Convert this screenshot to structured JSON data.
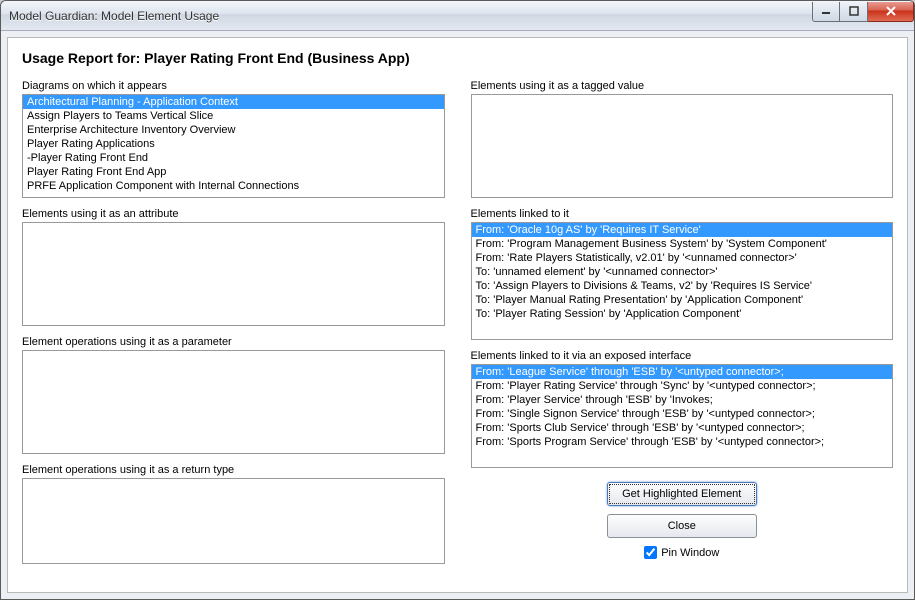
{
  "window": {
    "title": "Model Guardian: Model Element Usage"
  },
  "report": {
    "title": "Usage Report for: Player Rating Front End (Business App)"
  },
  "labels": {
    "diagrams": "Diagrams on which it appears",
    "tagged": "Elements using it as a tagged value",
    "attribute": "Elements using it as an attribute",
    "linked": "Elements linked to it",
    "parameter": "Element operations using it as a parameter",
    "exposed": "Elements linked to it via an exposed interface",
    "returntype": "Element operations using it as a return type"
  },
  "diagrams": {
    "items": [
      "Architectural Planning - Application Context",
      "Assign Players to Teams Vertical Slice",
      "Enterprise Architecture Inventory Overview",
      "Player Rating Applications",
      "-Player Rating Front End",
      "Player Rating Front End App",
      "PRFE Application Component with Internal Connections"
    ],
    "selectedIndex": 0
  },
  "linked": {
    "items": [
      "From:  'Oracle 10g AS' by 'Requires IT Service'",
      "From:  'Program Management Business System' by 'System Component'",
      "From:  'Rate Players Statistically, v2.01' by '<unnamed connector>'",
      "To:    'unnamed element' by '<unnamed connector>'",
      "To:    'Assign Players to Divisions & Teams, v2' by 'Requires IS Service'",
      "To:    'Player Manual Rating Presentation' by 'Application Component'",
      "To:    'Player Rating Session' by 'Application Component'"
    ],
    "selectedIndex": 0
  },
  "exposed": {
    "items": [
      "From:  'League Service' through 'ESB' by '<untyped connector>;",
      "From:  'Player Rating Service' through 'Sync' by '<untyped connector>;",
      "From:  'Player Service' through 'ESB' by 'Invokes;",
      "From:  'Single Signon Service' through 'ESB' by '<untyped connector>;",
      "From:  'Sports Club Service' through 'ESB' by '<untyped connector>;",
      "From:  'Sports Program Service' through 'ESB' by '<untyped connector>;"
    ],
    "selectedIndex": 0
  },
  "buttons": {
    "getHighlighted": "Get Highlighted Element",
    "close": "Close",
    "pin": "Pin Window"
  },
  "pinChecked": true
}
